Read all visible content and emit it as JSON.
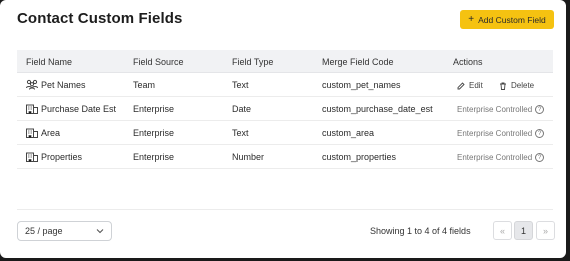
{
  "header": {
    "title": "Contact Custom Fields",
    "add_button": "Add Custom Field"
  },
  "columns": [
    "Field Name",
    "Field Source",
    "Field Type",
    "Merge Field Code",
    "Actions"
  ],
  "rows": [
    {
      "name": "Pet Names",
      "source": "Team",
      "type": "Text",
      "code": "custom_pet_names",
      "icon": "team-icon",
      "actions": {
        "edit": "Edit",
        "delete": "Delete"
      }
    },
    {
      "name": "Purchase Date Est",
      "source": "Enterprise",
      "type": "Date",
      "code": "custom_purchase_date_est",
      "icon": "building-icon",
      "status": "Enterprise Controlled"
    },
    {
      "name": "Area",
      "source": "Enterprise",
      "type": "Text",
      "code": "custom_area",
      "icon": "building-icon",
      "status": "Enterprise Controlled"
    },
    {
      "name": "Properties",
      "source": "Enterprise",
      "type": "Number",
      "code": "custom_properties",
      "icon": "building-icon",
      "status": "Enterprise Controlled"
    }
  ],
  "footer": {
    "page_size": "25 / page",
    "showing": "Showing 1 to 4 of 4 fields",
    "prev": "«",
    "current_page": "1",
    "next": "»"
  },
  "colors": {
    "accent": "#f5c211",
    "header_bg": "#f1f2f4"
  }
}
